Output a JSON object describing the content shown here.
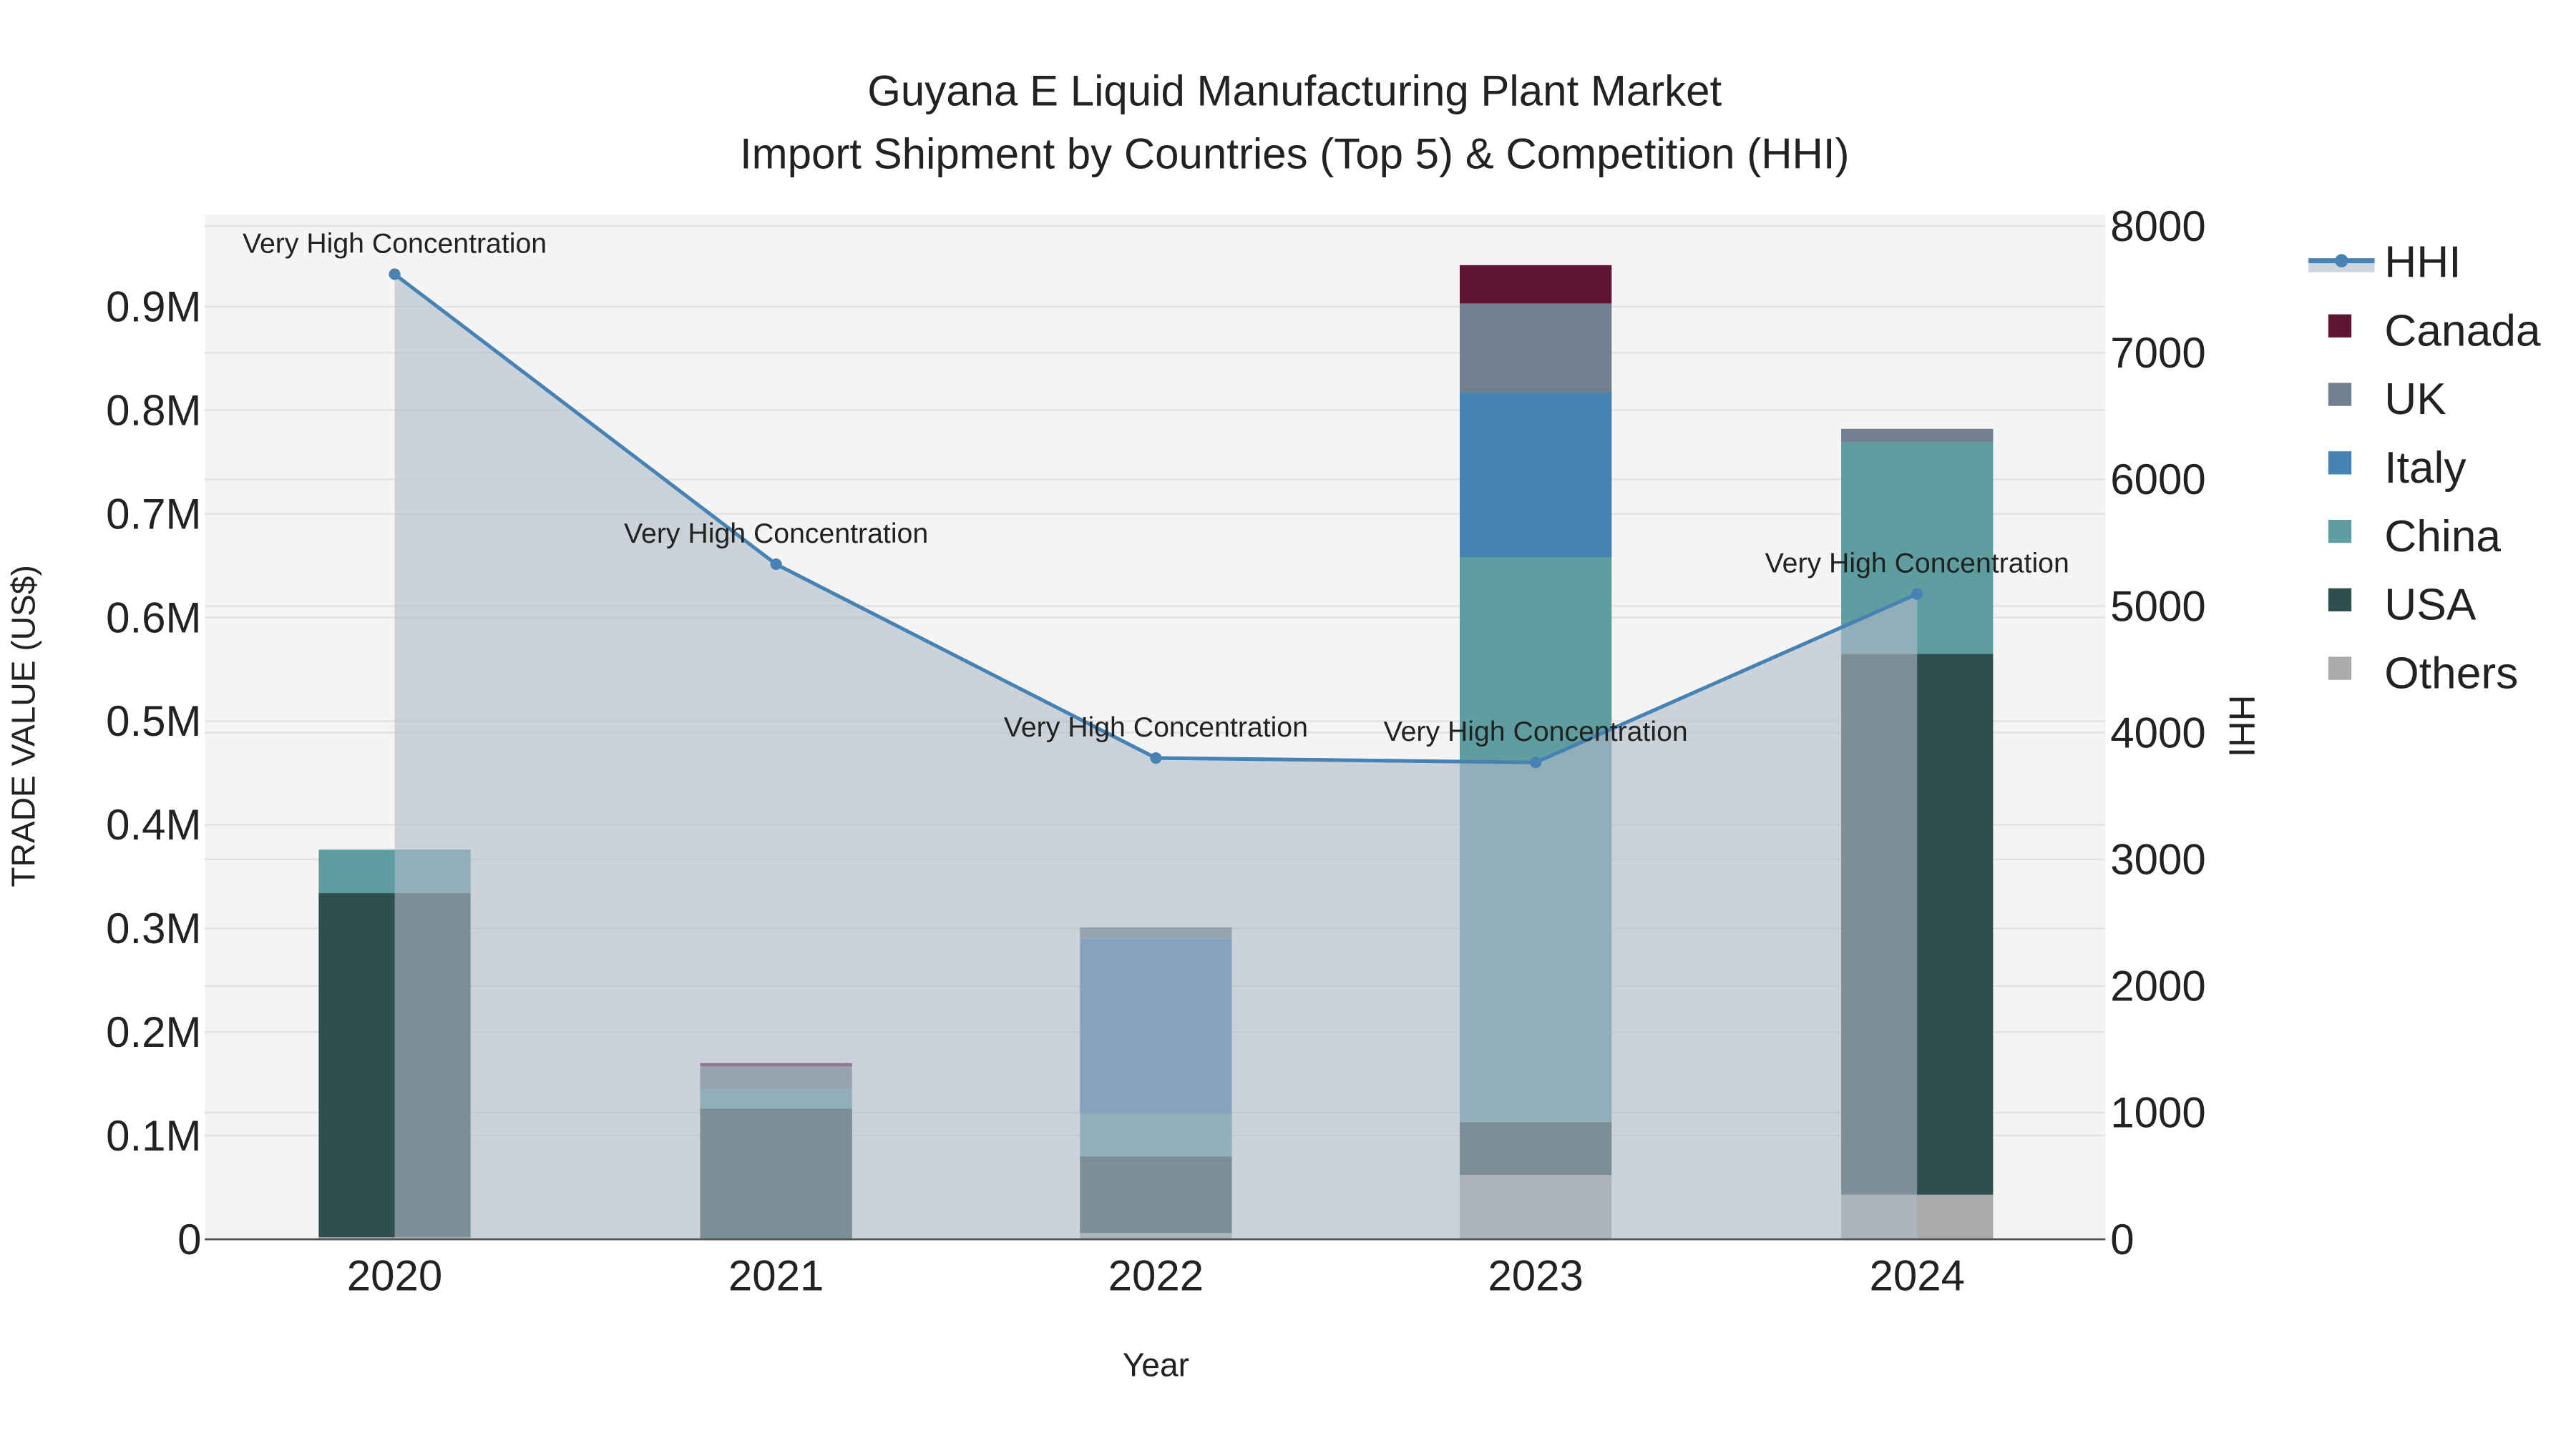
{
  "chart_data": {
    "type": "bar",
    "title": "Guyana E Liquid Manufacturing Plant Market",
    "subtitle": "Import Shipment by Countries (Top 5) & Competition (HHI)",
    "xlabel": "Year",
    "ylabel": "TRADE VALUE (US$)",
    "y2label": "HHI",
    "categories": [
      "2020",
      "2021",
      "2022",
      "2023",
      "2024"
    ],
    "ylim": [
      0,
      980000
    ],
    "y2lim": [
      0,
      8050
    ],
    "yticks": [
      {
        "v": 0,
        "label": "0"
      },
      {
        "v": 100000,
        "label": "0.1M"
      },
      {
        "v": 200000,
        "label": "0.2M"
      },
      {
        "v": 300000,
        "label": "0.3M"
      },
      {
        "v": 400000,
        "label": "0.4M"
      },
      {
        "v": 500000,
        "label": "0.5M"
      },
      {
        "v": 600000,
        "label": "0.6M"
      },
      {
        "v": 700000,
        "label": "0.7M"
      },
      {
        "v": 800000,
        "label": "0.8M"
      },
      {
        "v": 900000,
        "label": "0.9M"
      }
    ],
    "y2ticks": [
      "0",
      "1000",
      "2000",
      "3000",
      "4000",
      "5000",
      "6000",
      "7000",
      "8000"
    ],
    "grid": true,
    "legend_placement": "right",
    "series": [
      {
        "name": "Others",
        "color": "#aaaaaa",
        "values": [
          2000,
          0,
          6000,
          62000,
          43000
        ]
      },
      {
        "name": "USA",
        "color": "#2f4f4f",
        "values": [
          332000,
          126000,
          74000,
          51000,
          522000
        ]
      },
      {
        "name": "China",
        "color": "#5f9ea0",
        "values": [
          42000,
          19000,
          41000,
          545000,
          204000
        ]
      },
      {
        "name": "Italy",
        "color": "#4682b4",
        "values": [
          0,
          0,
          169000,
          159000,
          0
        ]
      },
      {
        "name": "UK",
        "color": "#708090",
        "values": [
          0,
          22000,
          11000,
          86000,
          13000
        ]
      },
      {
        "name": "Canada",
        "color": "#601434",
        "values": [
          0,
          3000,
          0,
          37000,
          0
        ]
      }
    ],
    "hhi": {
      "name": "HHI",
      "color": "#4682b4",
      "values": [
        7620,
        5330,
        3800,
        3765,
        5095
      ],
      "annotations": [
        "Very High Concentration",
        "Very High Concentration",
        "Very High Concentration",
        "Very High Concentration",
        "Very High Concentration"
      ]
    }
  }
}
